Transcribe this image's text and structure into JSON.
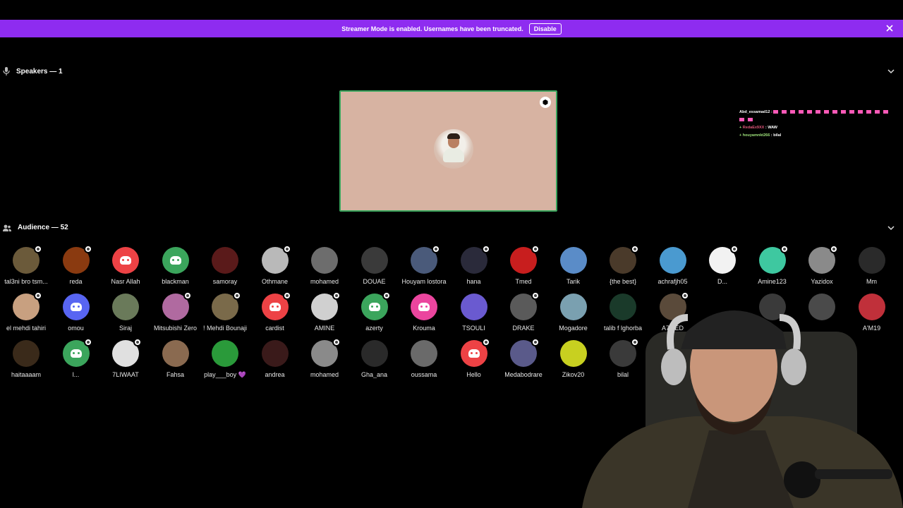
{
  "banner": {
    "text": "Streamer Mode is enabled. Usernames have been truncated.",
    "button": "Disable"
  },
  "speakers": {
    "title": "Speakers — 1"
  },
  "audience": {
    "title": "Audience — 52"
  },
  "chat": [
    {
      "name": "Abd_essamad12 :",
      "text": ""
    },
    {
      "name": "RedaEx9XX",
      "text": ": WAW"
    },
    {
      "name": "houyamnkt266",
      "text": ": bilal"
    }
  ],
  "members": [
    [
      {
        "name": "tal3ni bro tsm...",
        "color": "#6b5a3a",
        "muted": true,
        "discord": false
      },
      {
        "name": "reda",
        "color": "#8a3a10",
        "muted": true,
        "discord": false
      },
      {
        "name": "Nasr Allah",
        "color": "#ed4245",
        "muted": false,
        "discord": true
      },
      {
        "name": "blackman",
        "color": "#3ba55c",
        "muted": false,
        "discord": true
      },
      {
        "name": "samoray",
        "color": "#5a1a1a",
        "muted": false,
        "discord": false
      },
      {
        "name": "Othmane",
        "color": "#b9b9b9",
        "muted": true,
        "discord": false
      },
      {
        "name": "mohamed",
        "color": "#6d6d6d",
        "muted": false,
        "discord": false
      },
      {
        "name": "DOUAE",
        "color": "#3a3a3a",
        "muted": false,
        "discord": false
      },
      {
        "name": "Houyam lostora",
        "color": "#4a5a7a",
        "muted": true,
        "discord": false
      },
      {
        "name": "hana",
        "color": "#2a2a3a",
        "muted": true,
        "discord": false
      },
      {
        "name": "Tmed",
        "color": "#c81e1e",
        "muted": true,
        "discord": false
      },
      {
        "name": "Tarik",
        "color": "#5a8cc8",
        "muted": false,
        "discord": false
      },
      {
        "name": "{the best}",
        "color": "#4a3a2a",
        "muted": true,
        "discord": false
      },
      {
        "name": "achrafjh05",
        "color": "#4a9ad0",
        "muted": false,
        "discord": false
      },
      {
        "name": "D...",
        "color": "#f2f2f2",
        "muted": true,
        "discord": false
      },
      {
        "name": "Amine123",
        "color": "#3ec8a0",
        "muted": true,
        "discord": false
      },
      {
        "name": "Yazidox",
        "color": "#8a8a8a",
        "muted": true,
        "discord": false
      },
      {
        "name": "Mm",
        "color": "#2a2a2a",
        "muted": false,
        "discord": false
      }
    ],
    [
      {
        "name": "el mehdi tahiri",
        "color": "#c8a080",
        "muted": true,
        "discord": false
      },
      {
        "name": "omou",
        "color": "#5865f2",
        "muted": false,
        "discord": true
      },
      {
        "name": "Siraj",
        "color": "#6a7a5a",
        "muted": false,
        "discord": false
      },
      {
        "name": "Mitsubishi Zero",
        "color": "#b06aa0",
        "muted": true,
        "discord": false
      },
      {
        "name": "! Mehdi Bounaji",
        "color": "#7a6a4a",
        "muted": true,
        "discord": false
      },
      {
        "name": "cardist",
        "color": "#ed4245",
        "muted": true,
        "discord": true
      },
      {
        "name": "AMINE",
        "color": "#d0d0d0",
        "muted": true,
        "discord": false
      },
      {
        "name": "azerty",
        "color": "#3ba55c",
        "muted": true,
        "discord": true
      },
      {
        "name": "Krouma",
        "color": "#eb459e",
        "muted": false,
        "discord": true
      },
      {
        "name": "TSOULI",
        "color": "#6a5ad0",
        "muted": false,
        "discord": false
      },
      {
        "name": "DRAKE",
        "color": "#5a5a5a",
        "muted": true,
        "discord": false
      },
      {
        "name": "Mogadore",
        "color": "#7aa0b0",
        "muted": false,
        "discord": false
      },
      {
        "name": "talib f lghorba",
        "color": "#1a3a2a",
        "muted": false,
        "discord": false
      },
      {
        "name": "A7MED",
        "color": "#5a4a3a",
        "muted": true,
        "discord": false
      },
      {
        "name": "",
        "color": "#000000",
        "muted": false,
        "discord": false
      },
      {
        "name": "",
        "color": "#3a3a3a",
        "muted": false,
        "discord": false
      },
      {
        "name": "",
        "color": "#4a4a4a",
        "muted": false,
        "discord": false
      },
      {
        "name": "A'M19",
        "color": "#c0303a",
        "muted": false,
        "discord": false
      }
    ],
    [
      {
        "name": "haitaaaam",
        "color": "#3a2a1a",
        "muted": false,
        "discord": false
      },
      {
        "name": "l...",
        "color": "#3ba55c",
        "muted": true,
        "discord": true
      },
      {
        "name": "7LIWAAT",
        "color": "#e0e0e0",
        "muted": true,
        "discord": false
      },
      {
        "name": "Fahsa",
        "color": "#8a6a50",
        "muted": false,
        "discord": false
      },
      {
        "name": "play___boy 💜",
        "color": "#2a9a3a",
        "muted": false,
        "discord": false
      },
      {
        "name": "andrea",
        "color": "#3a1a1a",
        "muted": false,
        "discord": false
      },
      {
        "name": "mohamed",
        "color": "#8a8a8a",
        "muted": true,
        "discord": false
      },
      {
        "name": "Gha_ana",
        "color": "#2a2a2a",
        "muted": false,
        "discord": false
      },
      {
        "name": "oussama",
        "color": "#6a6a6a",
        "muted": false,
        "discord": false
      },
      {
        "name": "Hello",
        "color": "#ed4245",
        "muted": true,
        "discord": true
      },
      {
        "name": "Medabodrare",
        "color": "#5a5a8a",
        "muted": true,
        "discord": false
      },
      {
        "name": "Zikov20",
        "color": "#c8d020",
        "muted": false,
        "discord": false
      },
      {
        "name": "bilal",
        "color": "#3a3a3a",
        "muted": true,
        "discord": false
      }
    ]
  ]
}
